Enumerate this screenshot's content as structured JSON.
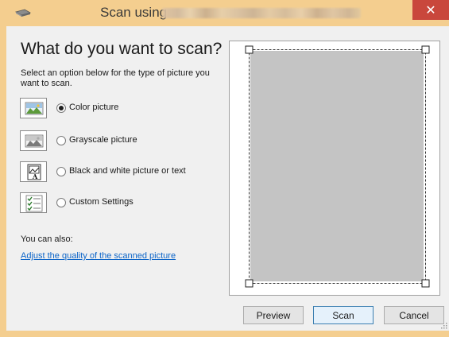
{
  "window": {
    "title": "Scan using",
    "close_symbol": "✕",
    "app_icon": "scanner-icon",
    "close_icon": "close-icon"
  },
  "main": {
    "heading": "What do you want to scan?",
    "subtext": "Select an option below for the type of picture you want to scan."
  },
  "options": [
    {
      "label": "Color picture",
      "icon": "color-picture-icon",
      "selected": true
    },
    {
      "label": "Grayscale picture",
      "icon": "grayscale-picture-icon",
      "selected": false
    },
    {
      "label": "Black and white picture or text",
      "icon": "black-white-picture-icon",
      "selected": false
    },
    {
      "label": "Custom Settings",
      "icon": "custom-settings-icon",
      "selected": false
    }
  ],
  "footer": {
    "also_label": "You can also:",
    "adjust_link": "Adjust the quality of the scanned picture"
  },
  "buttons": {
    "preview": "Preview",
    "scan": "Scan",
    "cancel": "Cancel"
  },
  "colors": {
    "titlebar": "#f4ce8f",
    "close_button": "#c9473c",
    "link": "#0b64c8",
    "preview_area": "#c4c4c4"
  }
}
